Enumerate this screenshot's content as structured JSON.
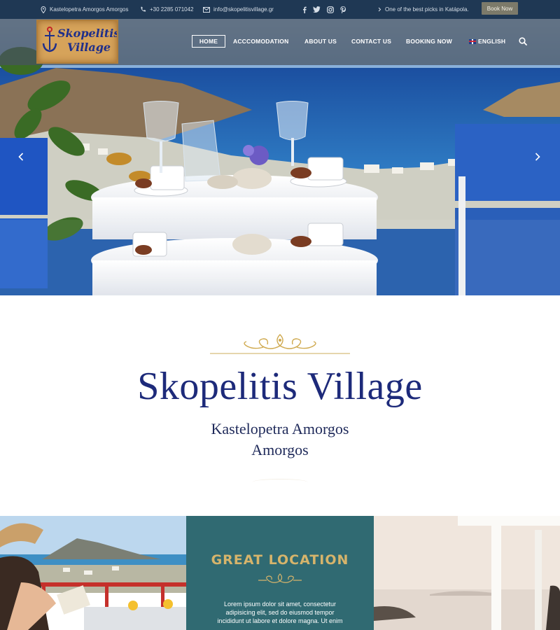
{
  "topbar": {
    "address": "Kastelopetra Amorgos Amorgos",
    "phone": "+30 2285 071042",
    "email": "info@skopelitisvillage.gr",
    "tagline": "One of the best picks in Katápola.",
    "book_label": "Book Now",
    "social": [
      "facebook-icon",
      "twitter-icon",
      "instagram-icon",
      "pinterest-icon"
    ]
  },
  "logo": {
    "line1": "Skopelitis",
    "line2": "Village"
  },
  "nav": {
    "items": [
      {
        "label": "HOME",
        "active": true
      },
      {
        "label": "ACCCOMODATION"
      },
      {
        "label": "ABOUT US"
      },
      {
        "label": "CONTACT US"
      },
      {
        "label": "BOOKING NOW"
      },
      {
        "label": "ENGLISH"
      }
    ]
  },
  "intro": {
    "title": "Skopelitis Village",
    "subtitle_line1": "Kastelopetra Amorgos",
    "subtitle_line2": "Amorgos"
  },
  "features": {
    "title": "GREAT LOCATION",
    "text": "Lorem ipsum dolor sit amet, consectetur adipisicing elit, sed do eiusmod tempor incididunt ut labore et dolore magna. Ut enim"
  },
  "colors": {
    "topbar_bg": "#1f3854",
    "accent_gold": "#d6b46b",
    "title_navy": "#1d2a7a",
    "feature_teal": "#306a72",
    "book_button": "#7c7a6a"
  }
}
